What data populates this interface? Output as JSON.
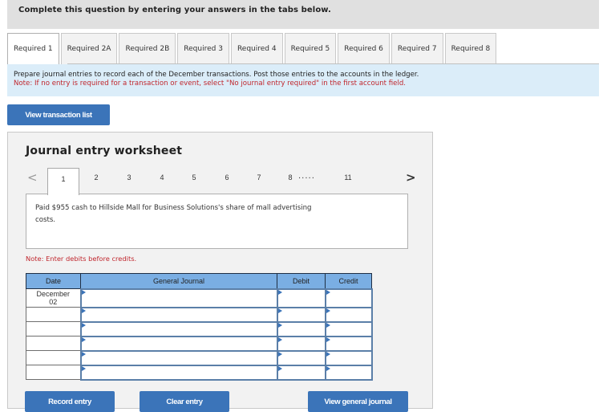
{
  "instructions": "Complete this question by entering your answers in the tabs below.",
  "tabs": [
    {
      "label": "Required 1",
      "active": true
    },
    {
      "label": "Required 2A",
      "active": false
    },
    {
      "label": "Required 2B",
      "active": false
    },
    {
      "label": "Required 3",
      "active": false
    },
    {
      "label": "Required 4",
      "active": false
    },
    {
      "label": "Required 5",
      "active": false
    },
    {
      "label": "Required 6",
      "active": false
    },
    {
      "label": "Required 7",
      "active": false
    },
    {
      "label": "Required 8",
      "active": false
    }
  ],
  "description": {
    "main": "Prepare journal entries to record each of the December transactions. Post those entries to the accounts in the ledger.",
    "note": "Note: If no entry is required for a transaction or event, select \"No journal entry required\" in the first account field."
  },
  "buttons": {
    "view_transaction_list": "View transaction list",
    "record_entry": "Record entry",
    "clear_entry": "Clear entry",
    "view_general_journal": "View general journal"
  },
  "worksheet": {
    "title": "Journal entry worksheet",
    "pager": {
      "prev": "<",
      "next": ">",
      "pages": [
        "1",
        "2",
        "3",
        "4",
        "5",
        "6",
        "7",
        "8"
      ],
      "ellipsis": ".....",
      "last": "11",
      "current": "1"
    },
    "transaction": "Paid $955 cash to Hillside Mall for Business Solutions's share of mall advertising costs.",
    "note": "Note: Enter debits before credits.",
    "table": {
      "headers": {
        "date": "Date",
        "general_journal": "General Journal",
        "debit": "Debit",
        "credit": "Credit"
      },
      "rows": [
        {
          "date": "December\n02",
          "account": "",
          "debit": "",
          "credit": ""
        },
        {
          "date": "",
          "account": "",
          "debit": "",
          "credit": ""
        },
        {
          "date": "",
          "account": "",
          "debit": "",
          "credit": ""
        },
        {
          "date": "",
          "account": "",
          "debit": "",
          "credit": ""
        },
        {
          "date": "",
          "account": "",
          "debit": "",
          "credit": ""
        },
        {
          "date": "",
          "account": "",
          "debit": "",
          "credit": ""
        }
      ]
    }
  },
  "colors": {
    "button_blue": "#3b74b9",
    "header_blue": "#7aaee3",
    "note_red": "#c0262d",
    "info_bg": "#dbedf9"
  }
}
